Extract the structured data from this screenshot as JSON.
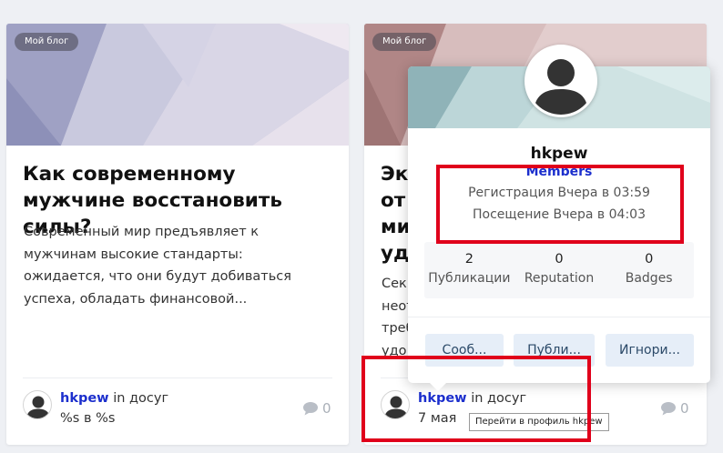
{
  "cards": [
    {
      "badge": "Мой блог",
      "title": "Как современному мужчине восстановить силы?",
      "excerpt": "Современный мир предъявляет к мужчинам высокие стандарты: ожидается, что они будут добиваться успеха, обладать финансовой...",
      "author": "hkpew",
      "in_word": "in",
      "category": "досуг",
      "date": "%s в %s",
      "comments": "0",
      "avatar_icon": "user-silhouette-icon",
      "comment_icon": "speech-bubble-icon"
    },
    {
      "badge": "Мой блог",
      "title_lines": [
        "Эк",
        "от",
        "ми",
        "удо"
      ],
      "excerpt_lines": [
        "Сек",
        "неот",
        "треб",
        "удо"
      ],
      "author": "hkpew",
      "in_word": "in",
      "category": "досуг",
      "date": "7 мая",
      "comments": "0",
      "avatar_icon": "user-silhouette-icon",
      "comment_icon": "speech-bubble-icon"
    }
  ],
  "hovercard": {
    "name": "hkpew",
    "group": "Members",
    "registration": "Регистрация Вчера в 03:59",
    "last_visit": "Посещение Вчера в 04:03",
    "stats": [
      {
        "value": "2",
        "label": "Публикации"
      },
      {
        "value": "0",
        "label": "Reputation"
      },
      {
        "value": "0",
        "label": "Badges"
      }
    ],
    "buttons": [
      "Сооб...",
      "Публи...",
      "Игнори..."
    ],
    "avatar_icon": "user-silhouette-icon"
  },
  "tooltip": "Перейти в профиль hkpew",
  "colors": {
    "link": "#1c2fcd",
    "highlight": "#e0001b",
    "button_bg": "#e6eef8",
    "button_text": "#2c4a69"
  }
}
